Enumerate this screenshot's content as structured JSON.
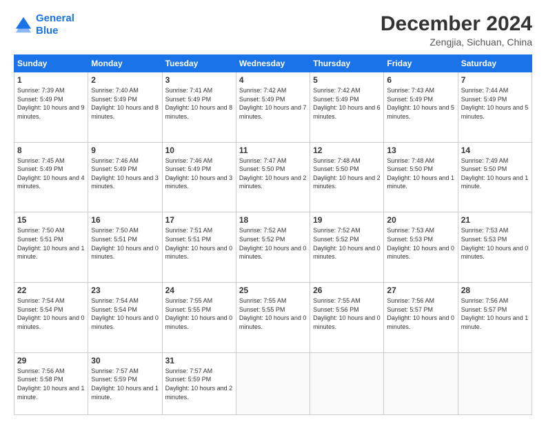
{
  "logo": {
    "line1": "General",
    "line2": "Blue"
  },
  "header": {
    "title": "December 2024",
    "subtitle": "Zengjia, Sichuan, China"
  },
  "weekdays": [
    "Sunday",
    "Monday",
    "Tuesday",
    "Wednesday",
    "Thursday",
    "Friday",
    "Saturday"
  ],
  "weeks": [
    [
      {
        "day": "1",
        "sunrise": "Sunrise: 7:39 AM",
        "sunset": "Sunset: 5:49 PM",
        "daylight": "Daylight: 10 hours and 9 minutes."
      },
      {
        "day": "2",
        "sunrise": "Sunrise: 7:40 AM",
        "sunset": "Sunset: 5:49 PM",
        "daylight": "Daylight: 10 hours and 8 minutes."
      },
      {
        "day": "3",
        "sunrise": "Sunrise: 7:41 AM",
        "sunset": "Sunset: 5:49 PM",
        "daylight": "Daylight: 10 hours and 8 minutes."
      },
      {
        "day": "4",
        "sunrise": "Sunrise: 7:42 AM",
        "sunset": "Sunset: 5:49 PM",
        "daylight": "Daylight: 10 hours and 7 minutes."
      },
      {
        "day": "5",
        "sunrise": "Sunrise: 7:42 AM",
        "sunset": "Sunset: 5:49 PM",
        "daylight": "Daylight: 10 hours and 6 minutes."
      },
      {
        "day": "6",
        "sunrise": "Sunrise: 7:43 AM",
        "sunset": "Sunset: 5:49 PM",
        "daylight": "Daylight: 10 hours and 5 minutes."
      },
      {
        "day": "7",
        "sunrise": "Sunrise: 7:44 AM",
        "sunset": "Sunset: 5:49 PM",
        "daylight": "Daylight: 10 hours and 5 minutes."
      }
    ],
    [
      {
        "day": "8",
        "sunrise": "Sunrise: 7:45 AM",
        "sunset": "Sunset: 5:49 PM",
        "daylight": "Daylight: 10 hours and 4 minutes."
      },
      {
        "day": "9",
        "sunrise": "Sunrise: 7:46 AM",
        "sunset": "Sunset: 5:49 PM",
        "daylight": "Daylight: 10 hours and 3 minutes."
      },
      {
        "day": "10",
        "sunrise": "Sunrise: 7:46 AM",
        "sunset": "Sunset: 5:49 PM",
        "daylight": "Daylight: 10 hours and 3 minutes."
      },
      {
        "day": "11",
        "sunrise": "Sunrise: 7:47 AM",
        "sunset": "Sunset: 5:50 PM",
        "daylight": "Daylight: 10 hours and 2 minutes."
      },
      {
        "day": "12",
        "sunrise": "Sunrise: 7:48 AM",
        "sunset": "Sunset: 5:50 PM",
        "daylight": "Daylight: 10 hours and 2 minutes."
      },
      {
        "day": "13",
        "sunrise": "Sunrise: 7:48 AM",
        "sunset": "Sunset: 5:50 PM",
        "daylight": "Daylight: 10 hours and 1 minute."
      },
      {
        "day": "14",
        "sunrise": "Sunrise: 7:49 AM",
        "sunset": "Sunset: 5:50 PM",
        "daylight": "Daylight: 10 hours and 1 minute."
      }
    ],
    [
      {
        "day": "15",
        "sunrise": "Sunrise: 7:50 AM",
        "sunset": "Sunset: 5:51 PM",
        "daylight": "Daylight: 10 hours and 1 minute."
      },
      {
        "day": "16",
        "sunrise": "Sunrise: 7:50 AM",
        "sunset": "Sunset: 5:51 PM",
        "daylight": "Daylight: 10 hours and 0 minutes."
      },
      {
        "day": "17",
        "sunrise": "Sunrise: 7:51 AM",
        "sunset": "Sunset: 5:51 PM",
        "daylight": "Daylight: 10 hours and 0 minutes."
      },
      {
        "day": "18",
        "sunrise": "Sunrise: 7:52 AM",
        "sunset": "Sunset: 5:52 PM",
        "daylight": "Daylight: 10 hours and 0 minutes."
      },
      {
        "day": "19",
        "sunrise": "Sunrise: 7:52 AM",
        "sunset": "Sunset: 5:52 PM",
        "daylight": "Daylight: 10 hours and 0 minutes."
      },
      {
        "day": "20",
        "sunrise": "Sunrise: 7:53 AM",
        "sunset": "Sunset: 5:53 PM",
        "daylight": "Daylight: 10 hours and 0 minutes."
      },
      {
        "day": "21",
        "sunrise": "Sunrise: 7:53 AM",
        "sunset": "Sunset: 5:53 PM",
        "daylight": "Daylight: 10 hours and 0 minutes."
      }
    ],
    [
      {
        "day": "22",
        "sunrise": "Sunrise: 7:54 AM",
        "sunset": "Sunset: 5:54 PM",
        "daylight": "Daylight: 10 hours and 0 minutes."
      },
      {
        "day": "23",
        "sunrise": "Sunrise: 7:54 AM",
        "sunset": "Sunset: 5:54 PM",
        "daylight": "Daylight: 10 hours and 0 minutes."
      },
      {
        "day": "24",
        "sunrise": "Sunrise: 7:55 AM",
        "sunset": "Sunset: 5:55 PM",
        "daylight": "Daylight: 10 hours and 0 minutes."
      },
      {
        "day": "25",
        "sunrise": "Sunrise: 7:55 AM",
        "sunset": "Sunset: 5:55 PM",
        "daylight": "Daylight: 10 hours and 0 minutes."
      },
      {
        "day": "26",
        "sunrise": "Sunrise: 7:55 AM",
        "sunset": "Sunset: 5:56 PM",
        "daylight": "Daylight: 10 hours and 0 minutes."
      },
      {
        "day": "27",
        "sunrise": "Sunrise: 7:56 AM",
        "sunset": "Sunset: 5:57 PM",
        "daylight": "Daylight: 10 hours and 0 minutes."
      },
      {
        "day": "28",
        "sunrise": "Sunrise: 7:56 AM",
        "sunset": "Sunset: 5:57 PM",
        "daylight": "Daylight: 10 hours and 1 minute."
      }
    ],
    [
      {
        "day": "29",
        "sunrise": "Sunrise: 7:56 AM",
        "sunset": "Sunset: 5:58 PM",
        "daylight": "Daylight: 10 hours and 1 minute."
      },
      {
        "day": "30",
        "sunrise": "Sunrise: 7:57 AM",
        "sunset": "Sunset: 5:59 PM",
        "daylight": "Daylight: 10 hours and 1 minute."
      },
      {
        "day": "31",
        "sunrise": "Sunrise: 7:57 AM",
        "sunset": "Sunset: 5:59 PM",
        "daylight": "Daylight: 10 hours and 2 minutes."
      },
      null,
      null,
      null,
      null
    ]
  ]
}
